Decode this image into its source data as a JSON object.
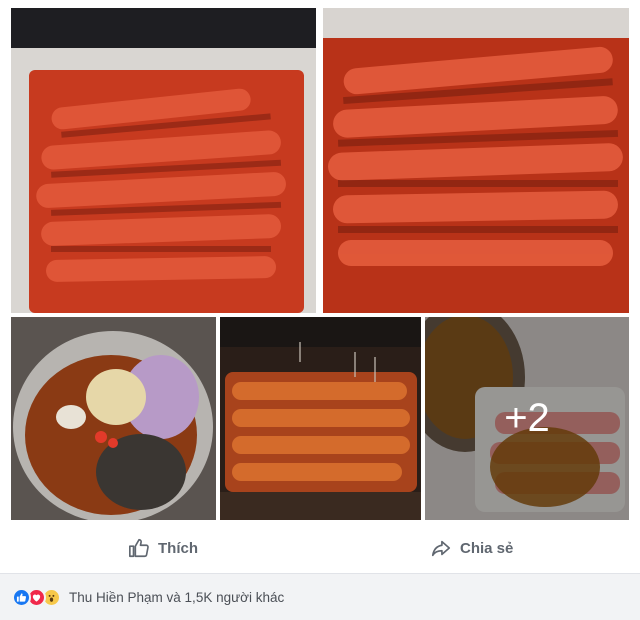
{
  "gallery": {
    "more_count": "+2"
  },
  "actions": {
    "like_label": "Thích",
    "share_label": "Chia sẻ"
  },
  "reactions": {
    "icons": [
      "like-icon",
      "love-icon",
      "wow-icon"
    ],
    "summary": "Thu Hiền Phạm và 1,5K người khác"
  },
  "colors": {
    "like": "#1877f2",
    "love": "#f0284a",
    "wow": "#f7c84a",
    "action_text": "#606770"
  }
}
